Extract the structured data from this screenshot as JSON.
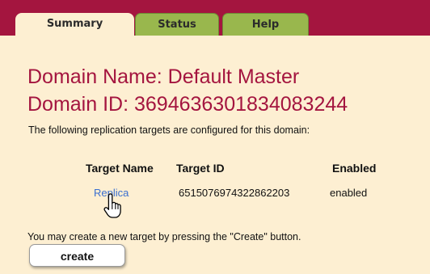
{
  "tabs": [
    {
      "label": "Summary",
      "active": true
    },
    {
      "label": "Status",
      "active": false
    },
    {
      "label": "Help",
      "active": false
    }
  ],
  "domain": {
    "name_line": "Domain Name: Default Master",
    "id_line": "Domain ID: 3694636301834083244"
  },
  "intro_text": "The following replication targets are configured for this domain:",
  "table": {
    "columns": [
      "Target Name",
      "Target ID",
      "Enabled"
    ],
    "rows": [
      {
        "name": "Replica",
        "id": "6515076974322862203",
        "enabled": "enabled"
      }
    ]
  },
  "create_note": "You may create a new target by pressing the \"Create\" button.",
  "create_button_label": "create",
  "colors": {
    "accent": "#a4153f",
    "background": "#fdefd2",
    "tab_inactive": "#99b74d",
    "link": "#3a6fd0"
  }
}
